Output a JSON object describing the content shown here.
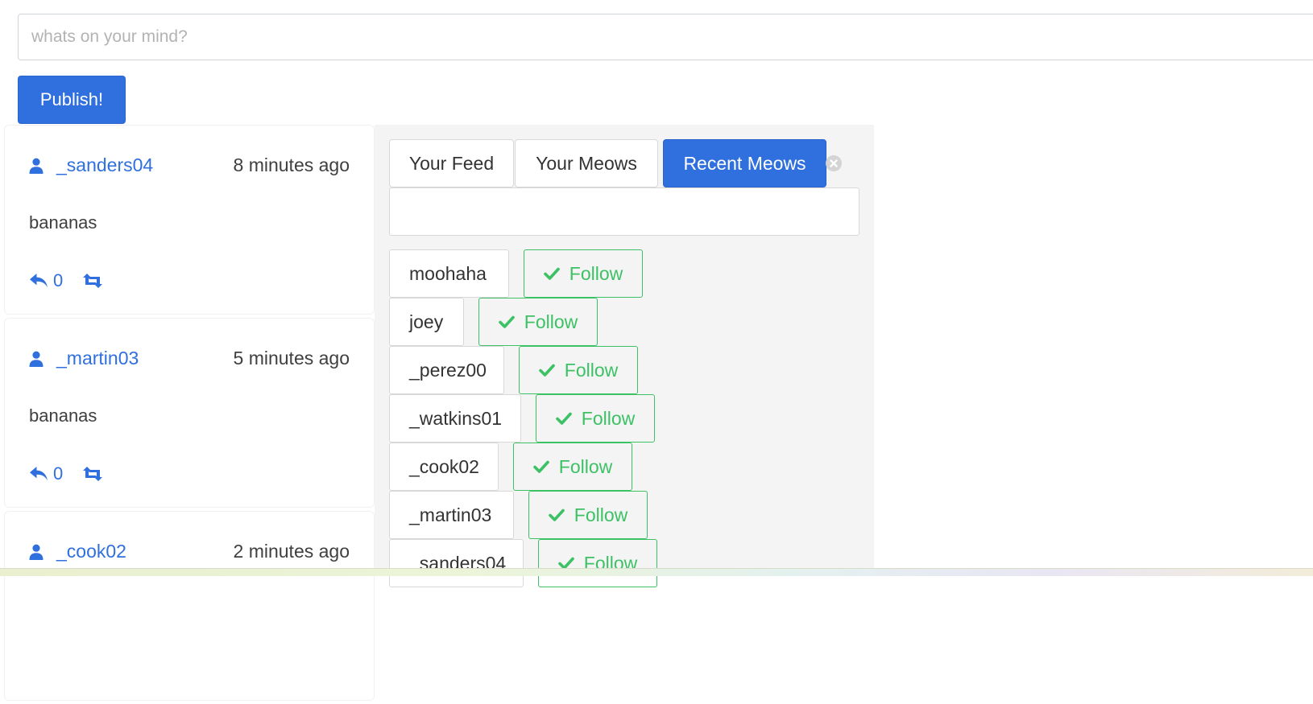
{
  "compose": {
    "placeholder": "whats on your mind?",
    "publish_label": "Publish!"
  },
  "feed": [
    {
      "username": "_sanders04",
      "time": "8 minutes ago",
      "text": "bananas",
      "replies": "0"
    },
    {
      "username": "_martin03",
      "time": "5 minutes ago",
      "text": "bananas",
      "replies": "0"
    },
    {
      "username": "_cook02",
      "time": "2 minutes ago",
      "text": "",
      "replies": ""
    }
  ],
  "tabs": [
    {
      "label": "Your Feed"
    },
    {
      "label": "Your Meows"
    },
    {
      "label": "Recent Meows",
      "active": true
    }
  ],
  "filter": {
    "value": ""
  },
  "users": [
    {
      "name": "moohaha",
      "follow_label": "Follow"
    },
    {
      "name": "joey",
      "follow_label": "Follow"
    },
    {
      "name": "_perez00",
      "follow_label": "Follow"
    },
    {
      "name": "_watkins01",
      "follow_label": "Follow"
    },
    {
      "name": "_cook02",
      "follow_label": "Follow"
    },
    {
      "name": "_martin03",
      "follow_label": "Follow"
    },
    {
      "name": "_sanders04",
      "follow_label": "Follow"
    }
  ],
  "icons": {
    "user": "user-icon",
    "reply": "reply-icon",
    "retweet": "retweet-icon",
    "check": "check-icon",
    "close": "close-icon"
  },
  "colors": {
    "primary": "#2f6fde",
    "follow_green": "#3cc165",
    "panel_bg": "#f4f4f4"
  }
}
